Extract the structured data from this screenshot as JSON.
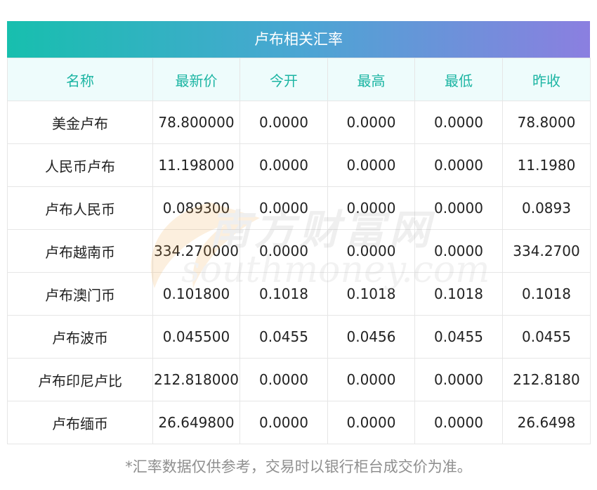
{
  "title": "卢布相关汇率",
  "table": {
    "headers": [
      "名称",
      "最新价",
      "今开",
      "最高",
      "最低",
      "昨收"
    ],
    "rows": [
      [
        "美金卢布",
        "78.800000",
        "0.0000",
        "0.0000",
        "0.0000",
        "78.8000"
      ],
      [
        "人民币卢布",
        "11.198000",
        "0.0000",
        "0.0000",
        "0.0000",
        "11.1980"
      ],
      [
        "卢布人民币",
        "0.089300",
        "0.0000",
        "0.0000",
        "0.0000",
        "0.0893"
      ],
      [
        "卢布越南币",
        "334.270000",
        "0.0000",
        "0.0000",
        "0.0000",
        "334.2700"
      ],
      [
        "卢布澳门币",
        "0.101800",
        "0.1018",
        "0.1018",
        "0.1018",
        "0.1018"
      ],
      [
        "卢布波币",
        "0.045500",
        "0.0455",
        "0.0456",
        "0.0455",
        "0.0455"
      ],
      [
        "卢布印尼卢比",
        "212.818000",
        "0.0000",
        "0.0000",
        "0.0000",
        "212.8180"
      ],
      [
        "卢布缅币",
        "26.649800",
        "0.0000",
        "0.0000",
        "0.0000",
        "26.6498"
      ]
    ]
  },
  "watermark": {
    "cn": "南方财富网",
    "en": "southmoney.com"
  },
  "footnote": "*汇率数据仅供参考，交易时以银行柜台成交价为准。",
  "colors": {
    "gradient_start": "#17bfae",
    "gradient_end": "#8b7fe0",
    "header_text": "#1cb5a3",
    "header_bg": "#eefcfc"
  }
}
